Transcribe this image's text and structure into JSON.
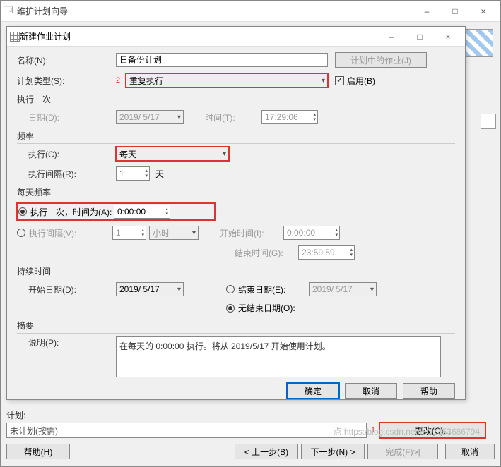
{
  "outer": {
    "title": "维护计划向导",
    "min": "–",
    "max": "□",
    "close": "×",
    "plan_label": "计划:",
    "plan_value": "未计划(按需)",
    "ann1": "1",
    "btn_help": "帮助(H)",
    "btn_prev": "< 上一步(B)",
    "btn_next": "下一步(N) >",
    "btn_finish": "完成(F)>|",
    "btn_cancel": "取消",
    "btn_change": "更改(C)..."
  },
  "dlg": {
    "title": "新建作业计划",
    "min": "–",
    "max": "□",
    "close": "×"
  },
  "name": {
    "label": "名称(N):",
    "value": "日备份计划",
    "jobs_btn": "计划中的作业(J)"
  },
  "type": {
    "label": "计划类型(S):",
    "ann": "2",
    "value": "重复执行",
    "enable": "启用(B)"
  },
  "once": {
    "group": "执行一次",
    "date_label": "日期(D):",
    "date": "2019/ 5/17",
    "time_label": "时间(T):",
    "time": "17:29:06"
  },
  "freq": {
    "group": "频率",
    "exec_label": "执行(C):",
    "exec": "每天",
    "int_label": "执行间隔(R):",
    "int": "1",
    "unit": "天"
  },
  "daily": {
    "group": "每天频率",
    "once_label": "执行一次，时间为(A):",
    "once_time": "0:00:00",
    "int_label": "执行间隔(V):",
    "int": "1",
    "unit": "小时",
    "start_label": "开始时间(I):",
    "start": "0:00:00",
    "end_label": "结束时间(G):",
    "end": "23:59:59"
  },
  "dur": {
    "group": "持续时间",
    "start_label": "开始日期(D):",
    "start": "2019/ 5/17",
    "end_label": "结束日期(E):",
    "end": "2019/ 5/17",
    "noend": "无结束日期(O):"
  },
  "sum": {
    "group": "摘要",
    "desc_label": "说明(P):",
    "desc": "在每天的 0:00:00 执行。将从 2019/5/17 开始使用计划。"
  },
  "dlg_btn": {
    "ok": "确定",
    "cancel": "取消",
    "help": "帮助"
  },
  "watermark": "点 https:/blog.csdn.net/HG1353686794"
}
